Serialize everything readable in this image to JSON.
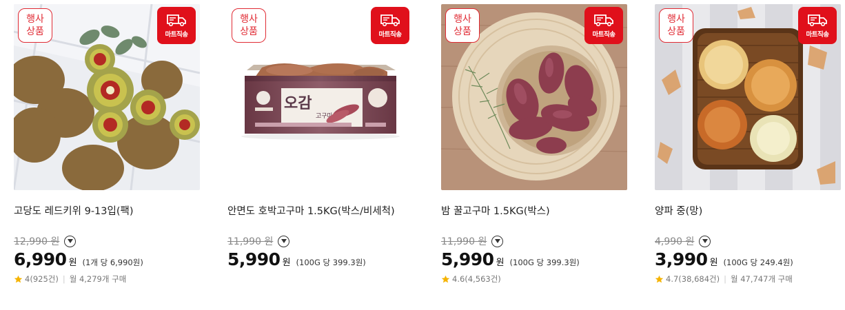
{
  "products": [
    {
      "event_badge": [
        "행사",
        "상품"
      ],
      "delivery_badge": "마트직송",
      "name": "고당도 레드키위 9-13입(팩)",
      "original_price": "12,990",
      "original_currency": "원",
      "price": "6,990",
      "currency": "원",
      "unit_price": "(1개 당 6,990원)",
      "rating": "4",
      "review_count": "(925건)",
      "purchase_count": "월 4,279개 구매",
      "icons": [
        "kiwi-photo",
        "truck-icon",
        "chevron-down-icon",
        "star-icon"
      ],
      "colors": {
        "accent": "#e0101b",
        "star": "#f5b301"
      }
    },
    {
      "event_badge": [
        "행사",
        "상품"
      ],
      "delivery_badge": "마트직송",
      "name": "안면도 호박고구마 1.5KG(박스/비세척)",
      "original_price": "11,990",
      "original_currency": "원",
      "price": "5,990",
      "currency": "원",
      "unit_price": "(100G 당 399.3원)",
      "box_brand": "오감",
      "box_sub": "고구마",
      "icons": [
        "sweet-potato-box-photo",
        "truck-icon",
        "chevron-down-icon"
      ],
      "colors": {
        "accent": "#e0101b"
      }
    },
    {
      "event_badge": [
        "행사",
        "상품"
      ],
      "delivery_badge": "마트직송",
      "name": "밤 꿀고구마 1.5KG(박스)",
      "original_price": "11,990",
      "original_currency": "원",
      "price": "5,990",
      "currency": "원",
      "unit_price": "(100G 당 399.3원)",
      "rating": "4.6",
      "review_count": "(4,563건)",
      "icons": [
        "sweet-potato-basket-photo",
        "truck-icon",
        "chevron-down-icon",
        "star-icon"
      ],
      "colors": {
        "accent": "#e0101b",
        "star": "#f5b301"
      }
    },
    {
      "event_badge": [
        "행사",
        "상품"
      ],
      "delivery_badge": "마트직송",
      "name": "양파 중(망)",
      "original_price": "4,990",
      "original_currency": "원",
      "price": "3,990",
      "currency": "원",
      "unit_price": "(100G 당 249.4원)",
      "rating": "4.7",
      "review_count": "(38,684건)",
      "purchase_count": "월 47,747개 구매",
      "icons": [
        "onion-basket-photo",
        "truck-icon",
        "chevron-down-icon",
        "star-icon"
      ],
      "colors": {
        "accent": "#e0101b",
        "star": "#f5b301"
      }
    }
  ]
}
